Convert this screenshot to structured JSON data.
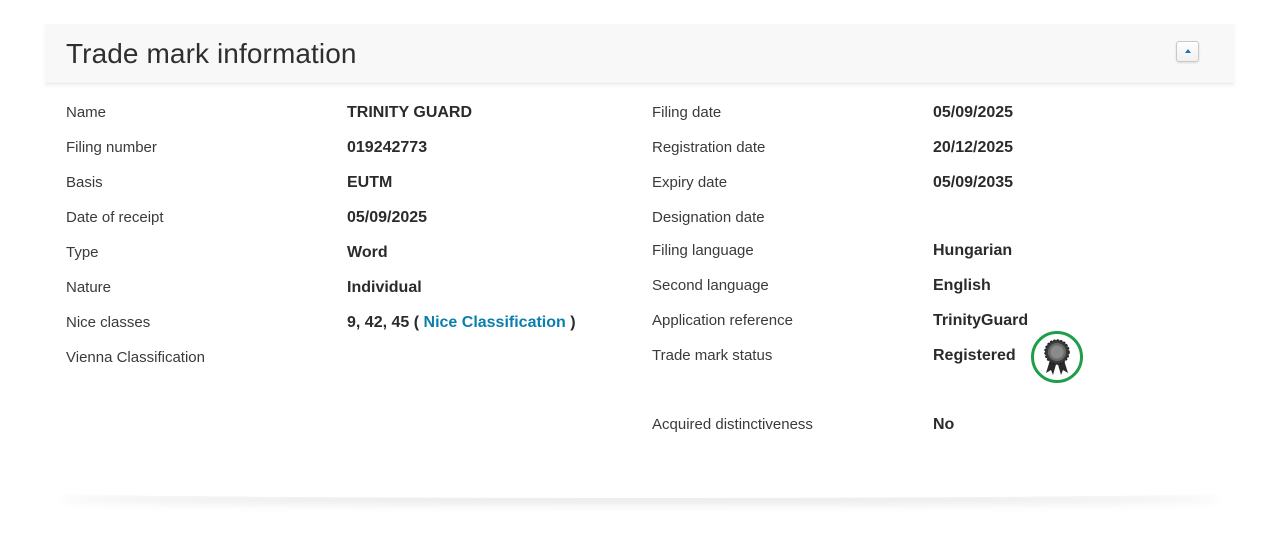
{
  "panel": {
    "title": "Trade mark information"
  },
  "left": [
    {
      "label": "Name",
      "value": "TRINITY GUARD"
    },
    {
      "label": "Filing number",
      "value": "019242773"
    },
    {
      "label": "Basis",
      "value": "EUTM"
    },
    {
      "label": "Date of receipt",
      "value": "05/09/2025"
    },
    {
      "label": "Type",
      "value": "Word"
    },
    {
      "label": "Nature",
      "value": "Individual"
    },
    {
      "label": "Nice classes",
      "value": "9, 42, 45",
      "link_prefix": "(",
      "link_text": "Nice Classification",
      "link_suffix": ")"
    },
    {
      "label": "Vienna Classification",
      "value": ""
    }
  ],
  "right": [
    {
      "label": "Filing date",
      "value": "05/09/2025"
    },
    {
      "label": "Registration date",
      "value": "20/12/2025"
    },
    {
      "label": "Expiry date",
      "value": "05/09/2035"
    },
    {
      "label": "Designation date",
      "value": ""
    },
    {
      "label": "Filing language",
      "value": "Hungarian"
    },
    {
      "label": "Second language",
      "value": "English"
    },
    {
      "label": "Application reference",
      "value": "TrinityGuard"
    },
    {
      "label": "Trade mark status",
      "value": "Registered"
    },
    {
      "label": "Acquired distinctiveness",
      "value": "No"
    }
  ],
  "icons": {
    "collapse": "chevron-up-icon",
    "status": "award-ribbon-icon"
  },
  "colors": {
    "link": "#0a7fae",
    "status_ring": "#1f9e4a",
    "header_bg": "#f8f8f8"
  }
}
